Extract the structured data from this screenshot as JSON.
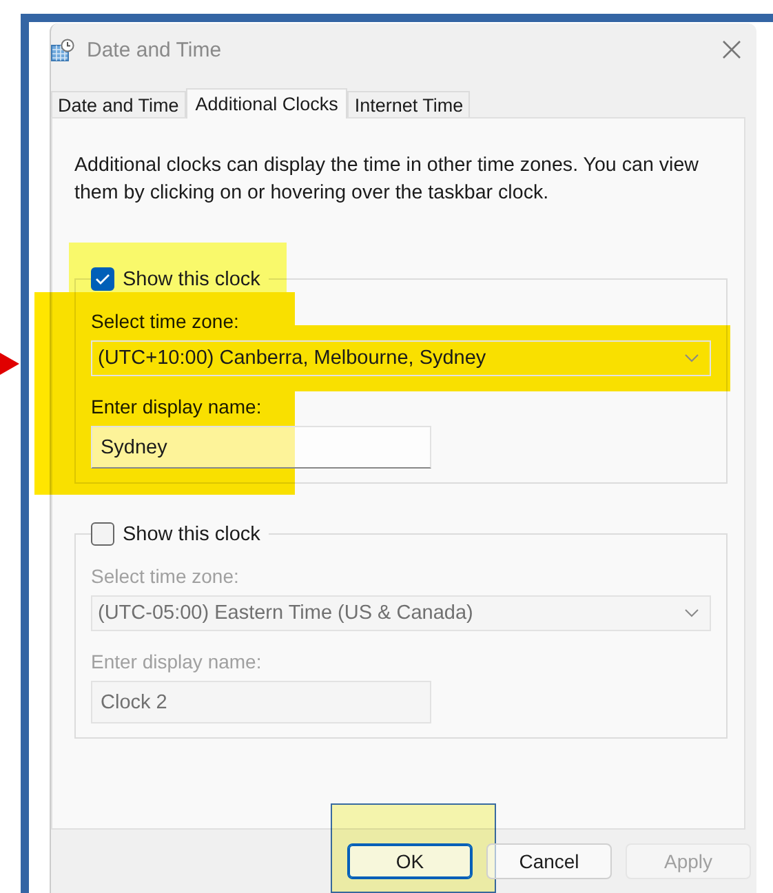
{
  "window": {
    "title": "Date and Time"
  },
  "tabs": [
    {
      "label": "Date and Time",
      "selected": false
    },
    {
      "label": "Additional Clocks",
      "selected": true
    },
    {
      "label": "Internet Time",
      "selected": false
    }
  ],
  "description": "Additional clocks can display the time in other time zones. You can view them by clicking on or hovering over the taskbar clock.",
  "clocks": [
    {
      "show_label": "Show this clock",
      "checked": true,
      "timezone_label": "Select time zone:",
      "timezone": "(UTC+10:00) Canberra, Melbourne, Sydney",
      "name_label": "Enter display name:",
      "display_name": "Sydney"
    },
    {
      "show_label": "Show this clock",
      "checked": false,
      "timezone_label": "Select time zone:",
      "timezone": "(UTC-05:00) Eastern Time (US & Canada)",
      "name_label": "Enter display name:",
      "display_name": "Clock 2"
    }
  ],
  "buttons": [
    {
      "label": "OK",
      "default": true,
      "disabled": false
    },
    {
      "label": "Cancel",
      "default": false,
      "disabled": false
    },
    {
      "label": "Apply",
      "default": false,
      "disabled": true
    }
  ]
}
